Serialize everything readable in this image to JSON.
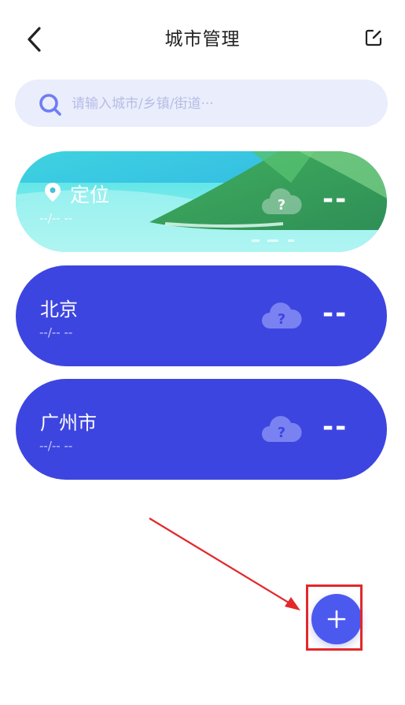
{
  "header": {
    "title": "城市管理",
    "back_icon": "chevron-left-icon",
    "edit_icon": "edit-icon"
  },
  "search": {
    "placeholder": "请输入城市/乡镇/街道···",
    "icon": "search-icon"
  },
  "cities": [
    {
      "name": "定位",
      "sub": "--/-- --",
      "temp": "--",
      "weather_icon": "cloud-question-icon",
      "location_icon": "location-pin-icon"
    },
    {
      "name": "北京",
      "sub": "--/-- --",
      "temp": "--",
      "weather_icon": "cloud-question-icon"
    },
    {
      "name": "广州市",
      "sub": "--/-- --",
      "temp": "--",
      "weather_icon": "cloud-question-icon"
    }
  ],
  "fab": {
    "label": "+",
    "icon": "plus-icon"
  },
  "colors": {
    "card_blue": "#3d45e0",
    "search_bg": "#eaedfb",
    "fab": "#4c59ef",
    "annotation_red": "#e3282b"
  }
}
